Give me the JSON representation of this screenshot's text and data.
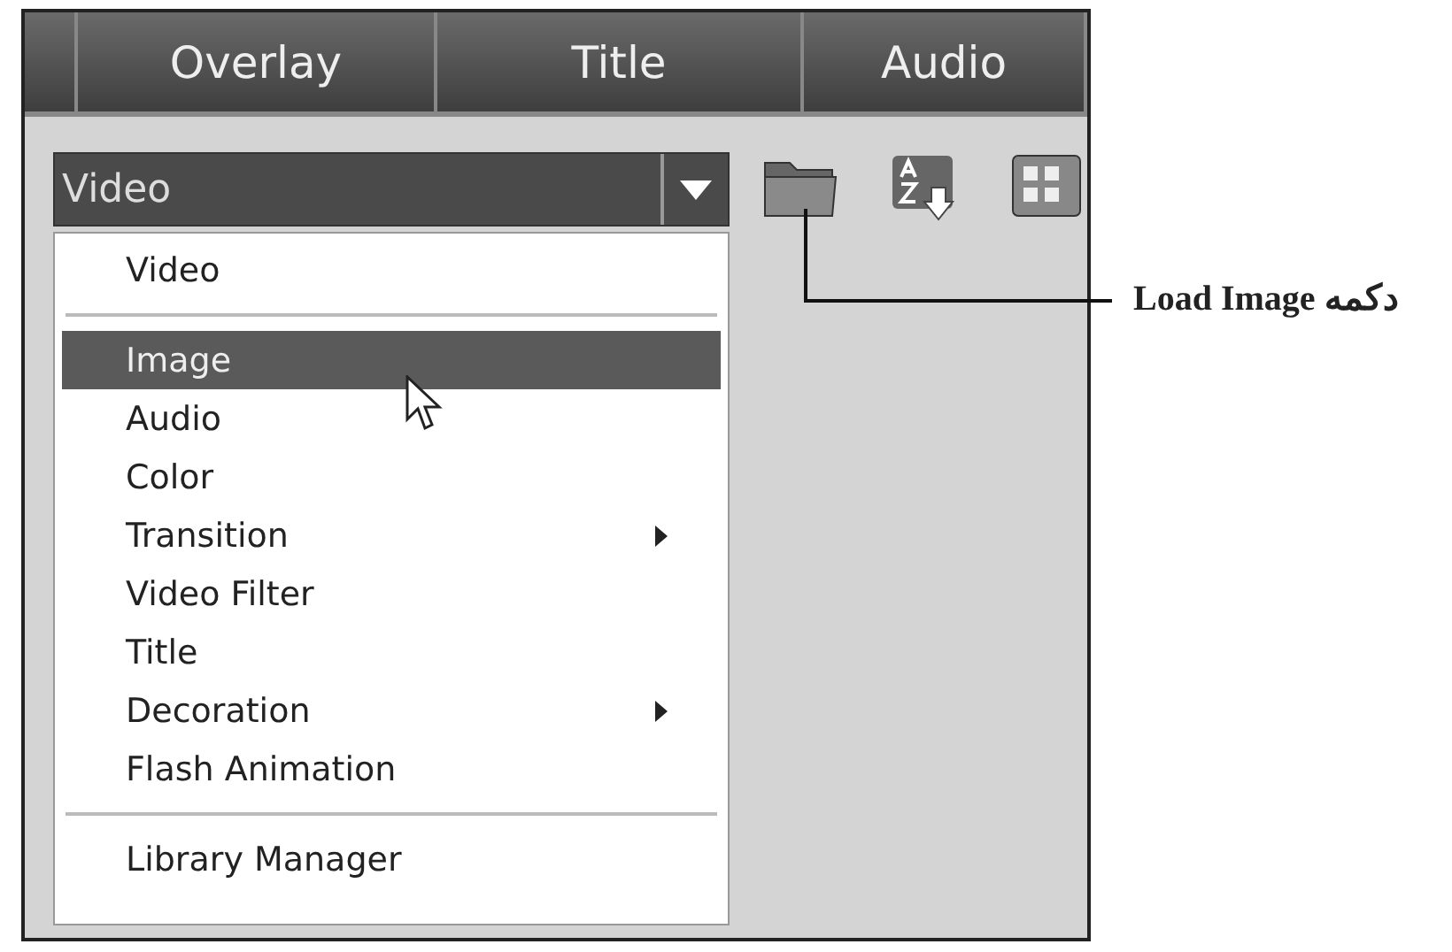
{
  "tabs": [
    {
      "selected": false
    },
    {
      "label": "Overlay",
      "selected": false
    },
    {
      "label": "Title",
      "selected": false
    },
    {
      "label": "Audio",
      "selected": false
    }
  ],
  "dropdown": {
    "value": "Video"
  },
  "menu": [
    {
      "kind": "item",
      "label": "Video",
      "selected": false,
      "submenu": false
    },
    {
      "kind": "separator"
    },
    {
      "kind": "item",
      "label": "Image",
      "selected": true,
      "submenu": false
    },
    {
      "kind": "item",
      "label": "Audio",
      "selected": false,
      "submenu": false
    },
    {
      "kind": "item",
      "label": "Color",
      "selected": false,
      "submenu": false
    },
    {
      "kind": "item",
      "label": "Transition",
      "selected": false,
      "submenu": true
    },
    {
      "kind": "item",
      "label": "Video Filter",
      "selected": false,
      "submenu": false
    },
    {
      "kind": "item",
      "label": "Title",
      "selected": false,
      "submenu": false
    },
    {
      "kind": "item",
      "label": "Decoration",
      "selected": false,
      "submenu": true
    },
    {
      "kind": "item",
      "label": "Flash Animation",
      "selected": false,
      "submenu": false
    },
    {
      "kind": "separator"
    },
    {
      "kind": "item",
      "label": "Library Manager",
      "selected": false,
      "submenu": false
    }
  ],
  "callout": {
    "text": "Load Image دکمه"
  }
}
